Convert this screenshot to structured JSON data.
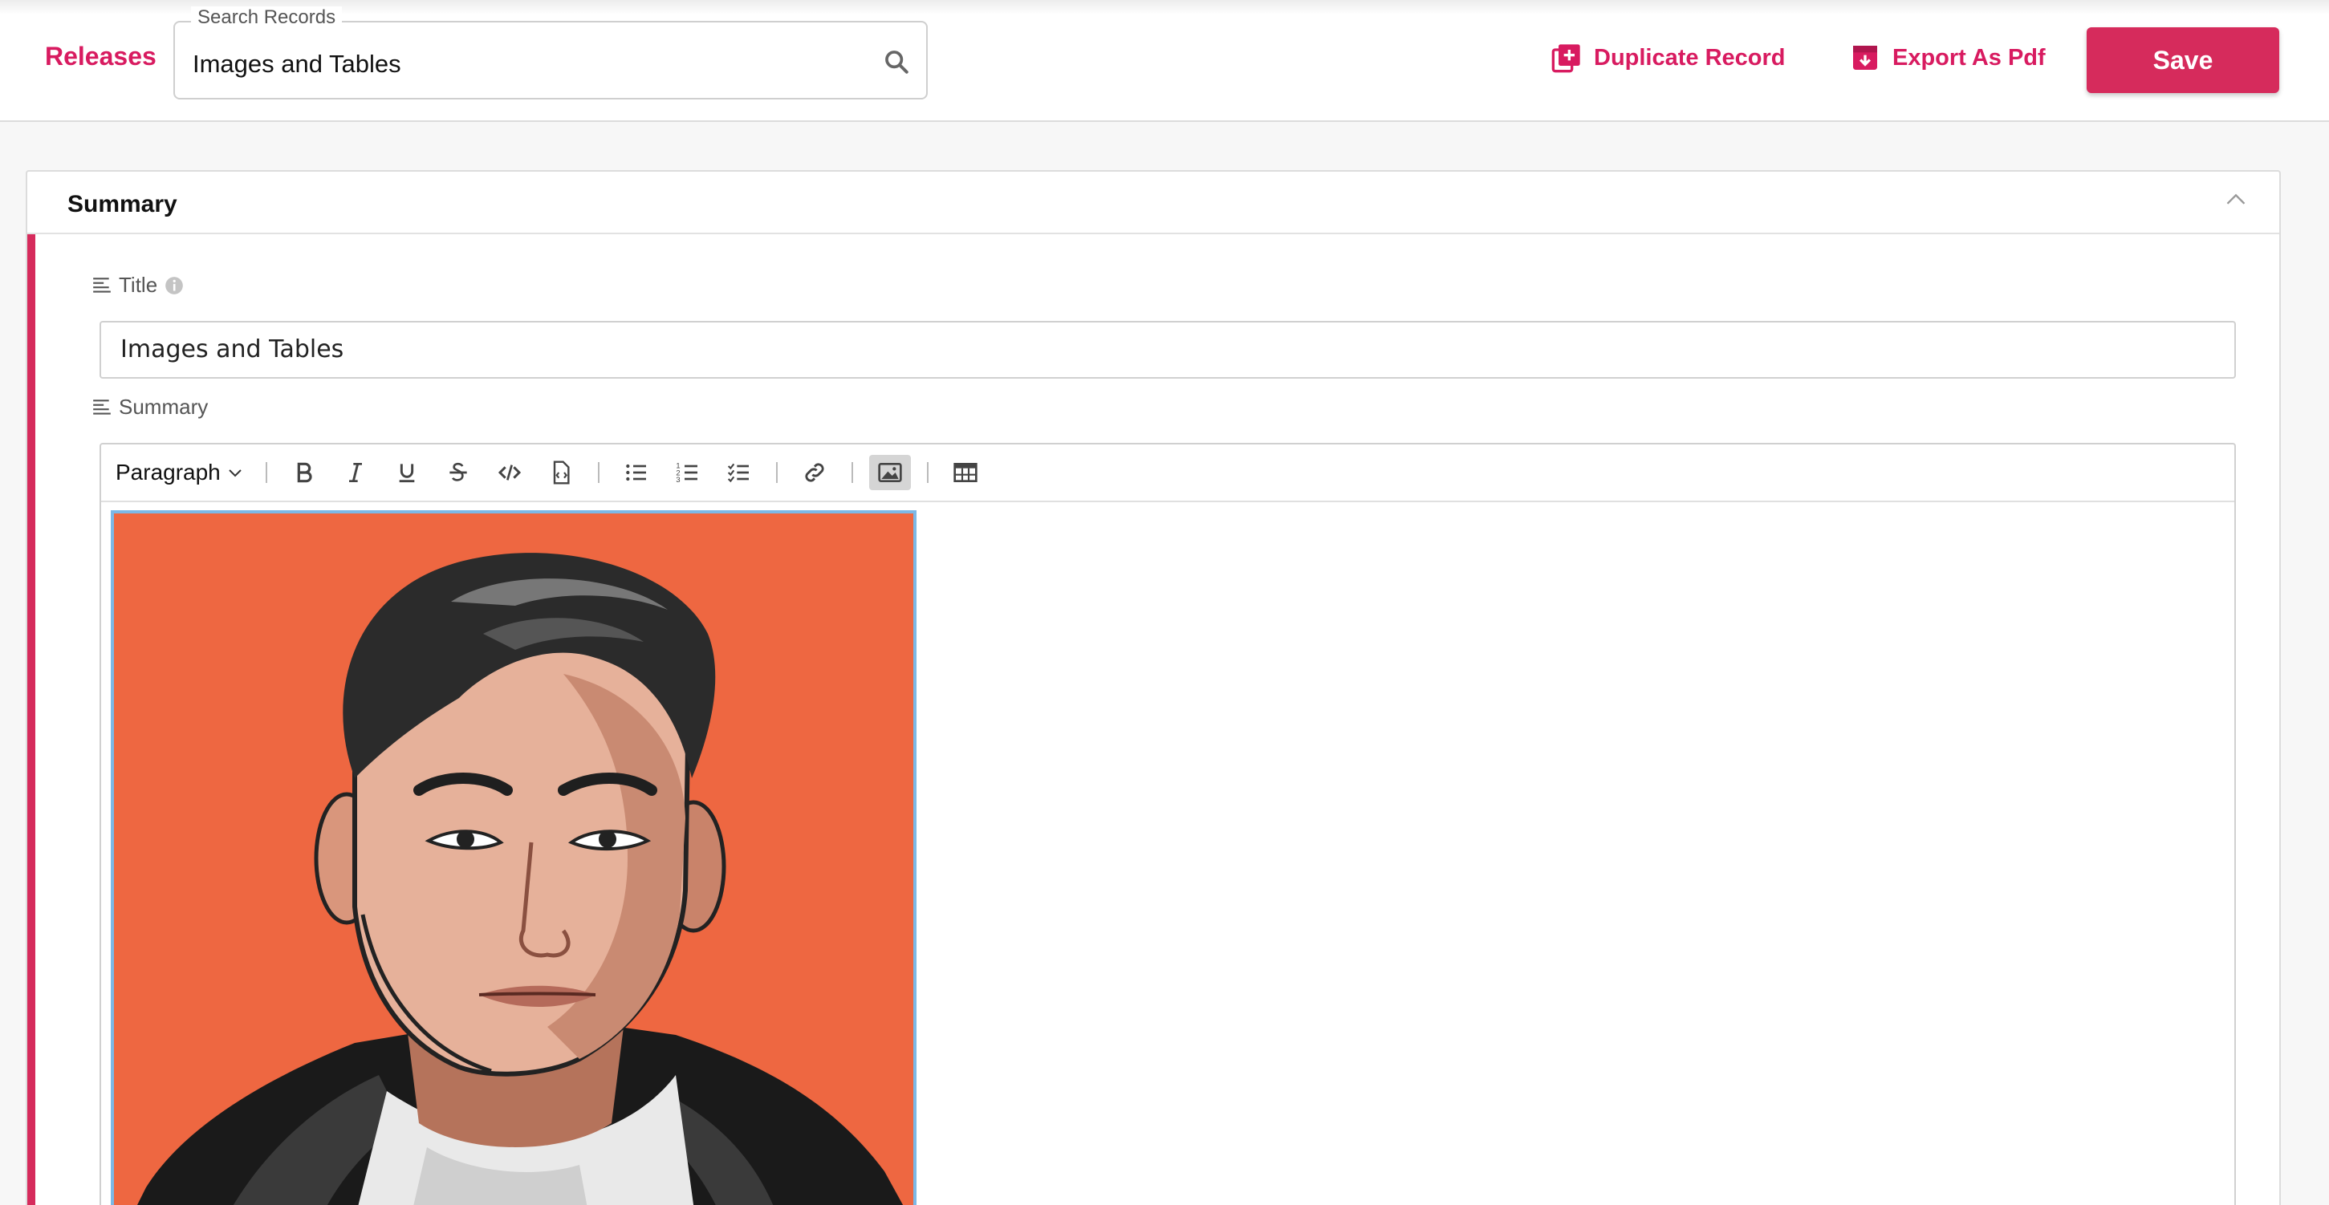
{
  "header": {
    "nav_label": "Releases",
    "search": {
      "legend": "Search Records",
      "value": "Images and Tables",
      "icon": "search-icon"
    },
    "duplicate_label": "Duplicate Record",
    "export_label": "Export As Pdf",
    "save_label": "Save",
    "accent_color": "#d81b60"
  },
  "panel": {
    "title": "Summary",
    "fields": {
      "title_label": "Title",
      "title_value": "Images and Tables",
      "summary_label": "Summary"
    },
    "editor": {
      "block_format": "Paragraph",
      "toolbar_icons": [
        "bold-icon",
        "italic-icon",
        "underline-icon",
        "strikethrough-icon",
        "code-icon",
        "code-block-icon",
        "bulleted-list-icon",
        "numbered-list-icon",
        "todo-list-icon",
        "link-icon",
        "image-icon",
        "table-icon"
      ],
      "image": {
        "description_icon": "portrait-illustration",
        "background": "#ee6741"
      }
    }
  }
}
